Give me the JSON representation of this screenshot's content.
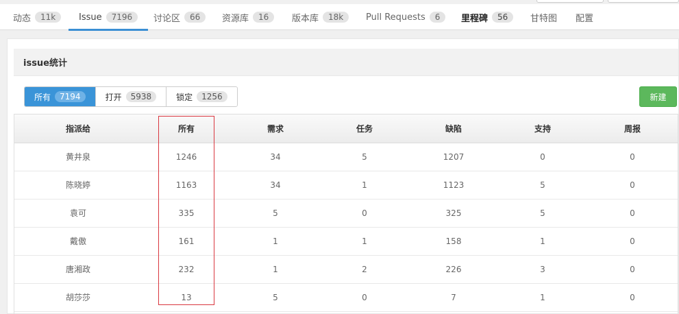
{
  "tabs": [
    {
      "label": "动态",
      "count": "11k"
    },
    {
      "label": "Issue",
      "count": "7196"
    },
    {
      "label": "讨论区",
      "count": "66"
    },
    {
      "label": "资源库",
      "count": "16"
    },
    {
      "label": "版本库",
      "count": "18k"
    },
    {
      "label": "Pull Requests",
      "count": "6"
    },
    {
      "label": "里程碑",
      "count": "56"
    },
    {
      "label": "甘特图",
      "count": null
    },
    {
      "label": "配置",
      "count": null
    }
  ],
  "panel": {
    "title": "issue统计"
  },
  "filters": [
    {
      "label": "所有",
      "count": "7194"
    },
    {
      "label": "打开",
      "count": "5938"
    },
    {
      "label": "锁定",
      "count": "1256"
    }
  ],
  "new_button": "新建",
  "table": {
    "headers": [
      "指派给",
      "所有",
      "需求",
      "任务",
      "缺陷",
      "支持",
      "周报"
    ],
    "rows": [
      [
        "黄井泉",
        "1246",
        "34",
        "5",
        "1207",
        "0",
        "0"
      ],
      [
        "陈晓婷",
        "1163",
        "34",
        "1",
        "1123",
        "5",
        "0"
      ],
      [
        "袁可",
        "335",
        "5",
        "0",
        "325",
        "5",
        "0"
      ],
      [
        "戴傲",
        "161",
        "1",
        "1",
        "158",
        "1",
        "0"
      ],
      [
        "唐湘政",
        "232",
        "1",
        "2",
        "226",
        "3",
        "0"
      ],
      [
        "胡莎莎",
        "13",
        "5",
        "0",
        "7",
        "1",
        "0"
      ]
    ]
  },
  "colors": {
    "accent": "#3a94d8",
    "success": "#5cb85c",
    "highlight": "#d9363e"
  }
}
